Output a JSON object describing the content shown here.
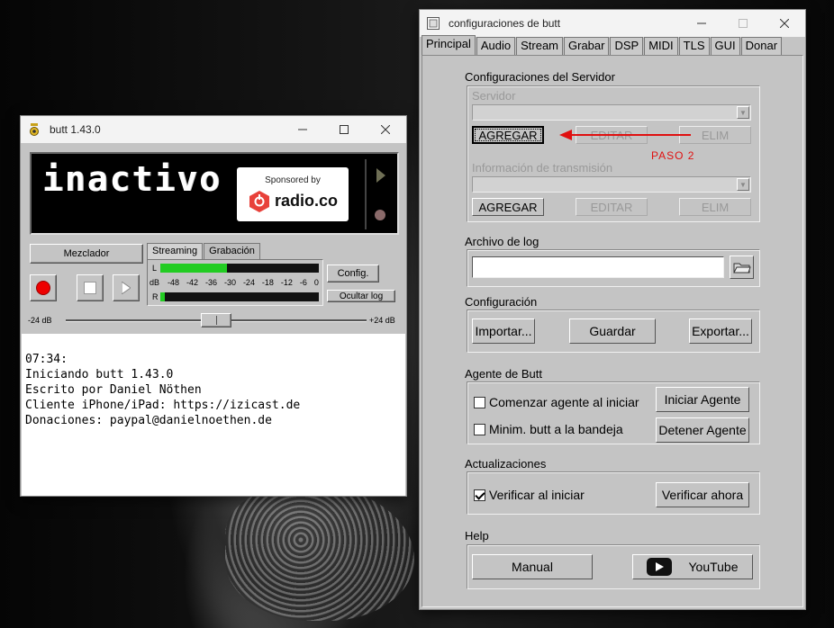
{
  "butt_window": {
    "title": "butt 1.43.0",
    "status": "inactivo",
    "sponsor_label": "Sponsored by",
    "sponsor_name": "radio.co",
    "mixer_label": "Mezclador",
    "vu_tabs": [
      "Streaming",
      "Grabación"
    ],
    "vu_channel_left": "L",
    "vu_channel_right": "R",
    "vu_unit": "dB",
    "vu_scale": [
      "-48",
      "-42",
      "-36",
      "-30",
      "-24",
      "-18",
      "-12",
      "-6",
      "0"
    ],
    "vu_level_left": 0.42,
    "vu_level_right": 0.03,
    "config_label": "Config.",
    "hide_log_label": "Ocultar log",
    "gain_min": "-24 dB",
    "gain_max": "+24 dB",
    "gain_value_db": 0,
    "log_lines": [
      "07:34:",
      "Iniciando butt 1.43.0",
      "Escrito por Daniel Nöthen",
      "Cliente iPhone/iPad: https://izicast.de",
      "Donaciones: paypal@danielnoethen.de"
    ]
  },
  "config_window": {
    "title": "configuraciones de butt",
    "tabs": [
      "Principal",
      "Audio",
      "Stream",
      "Grabar",
      "DSP",
      "MIDI",
      "TLS",
      "GUI",
      "Donar"
    ],
    "active_tab": "Principal",
    "server_section": {
      "title": "Configuraciones del Servidor",
      "server_label": "Servidor",
      "server_value": "",
      "stream_info_label": "Información de transmisión",
      "stream_info_value": "",
      "add_label": "AGREGAR",
      "edit_label": "EDITAR",
      "delete_label": "ELIM"
    },
    "annotation": "PASO 2",
    "annotation_color": "#e01010",
    "log_section": {
      "title": "Archivo de log",
      "value": ""
    },
    "config_section": {
      "title": "Configuración",
      "import_label": "Importar...",
      "save_label": "Guardar",
      "export_label": "Exportar..."
    },
    "agent_section": {
      "title": "Agente de Butt",
      "start_agent_check": "Comenzar agente al iniciar",
      "start_agent_checked": false,
      "minimize_check": "Minim. butt a la bandeja",
      "minimize_checked": false,
      "start_agent_button": "Iniciar Agente",
      "stop_agent_button": "Detener Agente"
    },
    "updates_section": {
      "title": "Actualizaciones",
      "check_on_start": "Verificar al iniciar",
      "check_on_start_checked": true,
      "check_now_button": "Verificar ahora"
    },
    "help_section": {
      "title": "Help",
      "manual_label": "Manual",
      "youtube_label": "YouTube"
    }
  }
}
